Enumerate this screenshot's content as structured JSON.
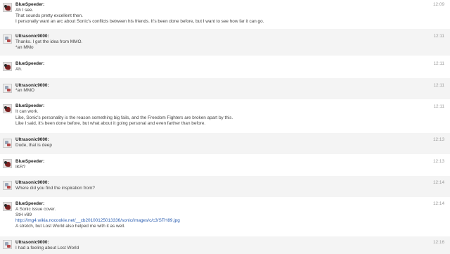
{
  "messages": [
    {
      "author": "BlueSpeeder:",
      "time": "12:09",
      "avatar": "bluespeeder-avatar",
      "lines": [
        "Ah I see.",
        "That sounds pretty excellent then.",
        "I personally want an arc about Sonic's conflicts between his friends. It's been done before, but I want to see how far it can go."
      ]
    },
    {
      "author": "Ultrasonic9000:",
      "time": "12:11",
      "avatar": "ultrasonic-avatar",
      "lines": [
        "Thanks. I got the idea from MMO.",
        "*an MMo"
      ]
    },
    {
      "author": "BlueSpeeder:",
      "time": "12:11",
      "avatar": "bluespeeder-avatar",
      "lines": [
        "Ah."
      ]
    },
    {
      "author": "Ultrasonic9000:",
      "time": "12:11",
      "avatar": "ultrasonic-avatar",
      "lines": [
        "*an MMO"
      ]
    },
    {
      "author": "BlueSpeeder:",
      "time": "12:11",
      "avatar": "bluespeeder-avatar",
      "lines": [
        "It can work.",
        "Like, Sonic's personality is the reason something big fails, and the Freedom Fighters are broken apart by this.",
        "Like I said, it's been done before, but what about it going personal and even farther than before."
      ]
    },
    {
      "author": "Ultrasonic9000:",
      "time": "12:13",
      "avatar": "ultrasonic-avatar",
      "lines": [
        "Dude, that is deep"
      ]
    },
    {
      "author": "BlueSpeeder:",
      "time": "12:13",
      "avatar": "bluespeeder-avatar",
      "lines": [
        "IKR?"
      ]
    },
    {
      "author": "Ultrasonic9000:",
      "time": "12:14",
      "avatar": "ultrasonic-avatar",
      "lines": [
        "Where did you find the inspiration from?"
      ]
    },
    {
      "author": "BlueSpeeder:",
      "time": "12:14",
      "avatar": "bluespeeder-avatar",
      "lines": [
        "A Sonic issue cover.",
        "StH #89",
        "http://img4.wikia.nocookie.net/__cb20100125013336/sonic/images/c/c3/STH89.jpg",
        "A stretch, but Lost World also helped me with it as well."
      ]
    },
    {
      "author": "Ultrasonic9000:",
      "time": "12:16",
      "avatar": "ultrasonic-avatar",
      "lines": [
        "I had a feeling about Lost World"
      ]
    }
  ]
}
